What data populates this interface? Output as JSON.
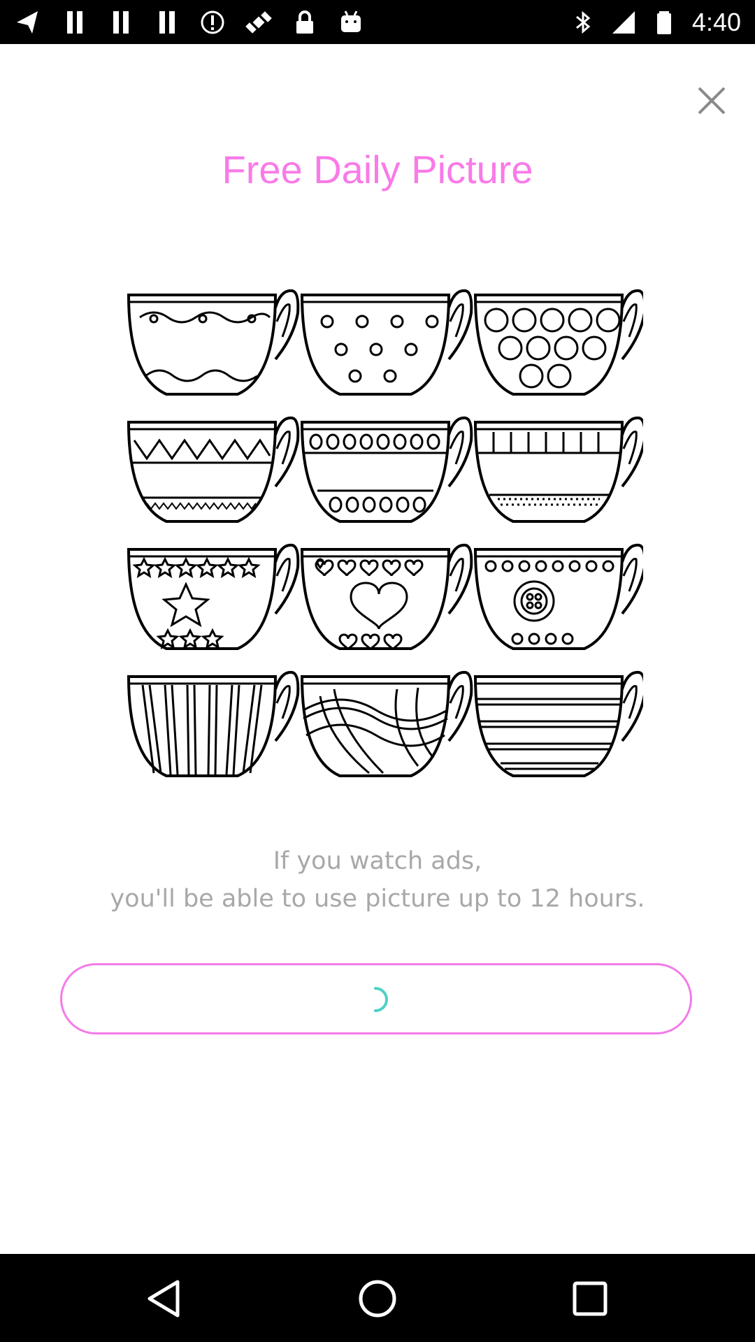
{
  "status_bar": {
    "time": "4:40",
    "icons": [
      "navigation-icon",
      "bars-icon",
      "bars-icon",
      "bars-icon",
      "info-icon",
      "satellite-fake-icon",
      "lock-icon",
      "android-icon",
      "bluetooth-icon",
      "signal-icon",
      "battery-icon"
    ]
  },
  "dialog": {
    "title": "Free Daily Picture",
    "message_line1": "If you watch ads,",
    "message_line2": "you'll be able to use picture up to 12 hours.",
    "accent_color": "#f97ae8",
    "button_state": "loading"
  },
  "navigation_bar": {
    "buttons": [
      "back",
      "home",
      "recents"
    ]
  }
}
